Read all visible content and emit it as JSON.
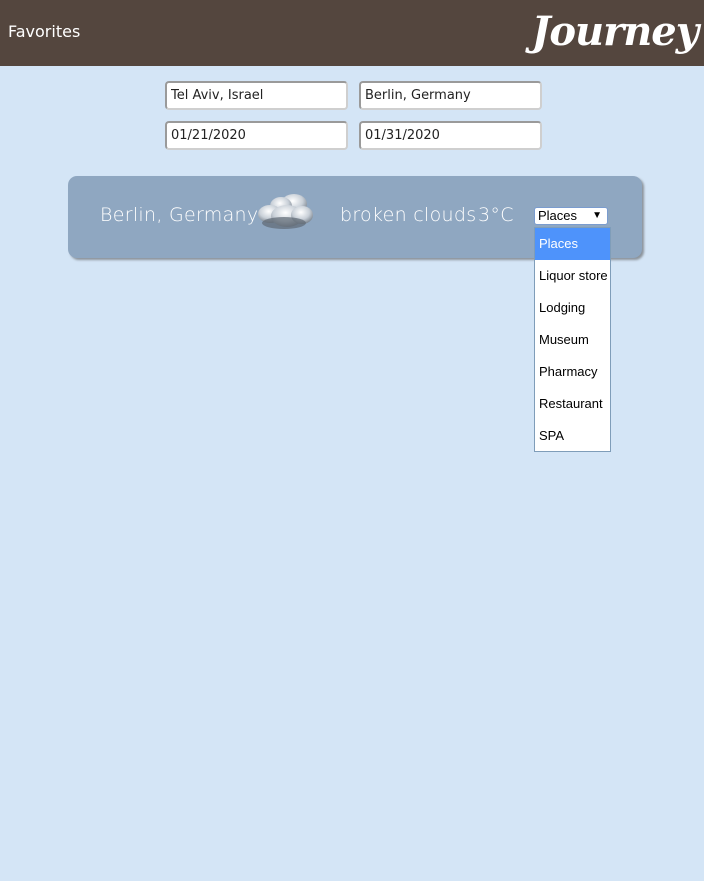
{
  "header": {
    "favorites_label": "Favorites",
    "logo": "Journey"
  },
  "search": {
    "origin_value": "Tel Aviv, Israel",
    "destination_value": "Berlin, Germany",
    "start_date_value": "01/21/2020",
    "end_date_value": "01/31/2020"
  },
  "weather": {
    "city": "Berlin, Germany",
    "icon": "broken-clouds-icon",
    "description": "broken clouds",
    "temperature": "3°C"
  },
  "places_select": {
    "selected": "Places",
    "options": [
      "Places",
      "Liquor store",
      "Lodging",
      "Museum",
      "Pharmacy",
      "Restaurant",
      "SPA"
    ]
  },
  "colors": {
    "header_bg": "#54463e",
    "page_bg": "#d4e5f6",
    "card_bg": "#8fa7c1",
    "selected_option": "#4e93fb"
  }
}
